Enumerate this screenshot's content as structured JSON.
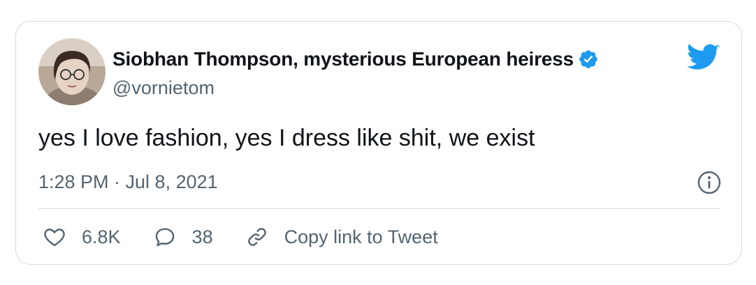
{
  "tweet": {
    "author": {
      "display_name": "Siobhan Thompson, mysterious European heiress",
      "handle": "@vornietom",
      "verified": true,
      "avatar_icon": "profile-photo"
    },
    "text": "yes I love fashion, yes I dress like shit, we exist",
    "timestamp": "1:28 PM · Jul 8, 2021",
    "actions": {
      "like_count": "6.8K",
      "reply_count": "38",
      "copy_link_label": "Copy link to Tweet"
    }
  },
  "icons": {
    "brand": "twitter-bird-icon",
    "verified": "verified-badge-icon",
    "info": "info-icon",
    "like": "heart-icon",
    "reply": "speech-bubble-icon",
    "link": "link-icon"
  },
  "colors": {
    "brand_blue": "#1d9bf0",
    "text_primary": "#0f1419",
    "text_secondary": "#536471",
    "border": "#cfd9de"
  }
}
